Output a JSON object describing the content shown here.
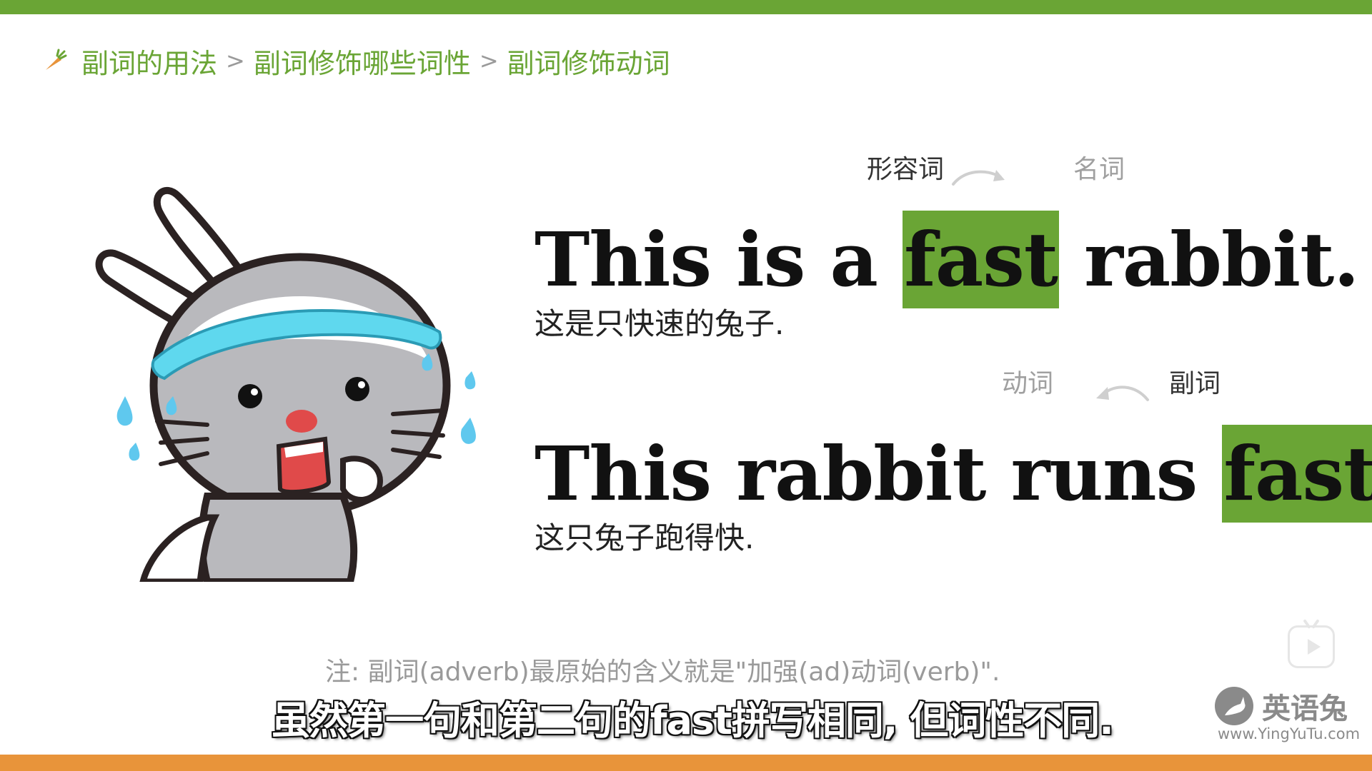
{
  "breadcrumb": {
    "items": [
      "副词的用法",
      "副词修饰哪些词性",
      "副词修饰动词"
    ],
    "separator": ">"
  },
  "example1": {
    "label_adj": "形容词",
    "label_noun": "名词",
    "sentence_before": "This is a ",
    "highlight": "fast",
    "sentence_after": " rabbit.",
    "translation": "这是只快速的兔子."
  },
  "example2": {
    "label_verb": "动词",
    "label_adverb": "副词",
    "sentence_before": "This rabbit runs ",
    "highlight": "fast",
    "sentence_after": ".",
    "translation": "这只兔子跑得快."
  },
  "note": "注: 副词(adverb)最原始的含义就是\"加强(ad)动词(verb)\".",
  "subtitle": "虽然第一句和第二句的fast拼写相同, 但词性不同.",
  "watermark": {
    "name": "英语兔",
    "url": "www.YingYuTu.com"
  },
  "colors": {
    "accent_green": "#6aa535",
    "accent_orange": "#e8943a",
    "label_gray": "#a0a0a0"
  },
  "icons": [
    "carrot-icon",
    "rabbit-illustration",
    "play-icon",
    "rabbit-logo-icon"
  ]
}
